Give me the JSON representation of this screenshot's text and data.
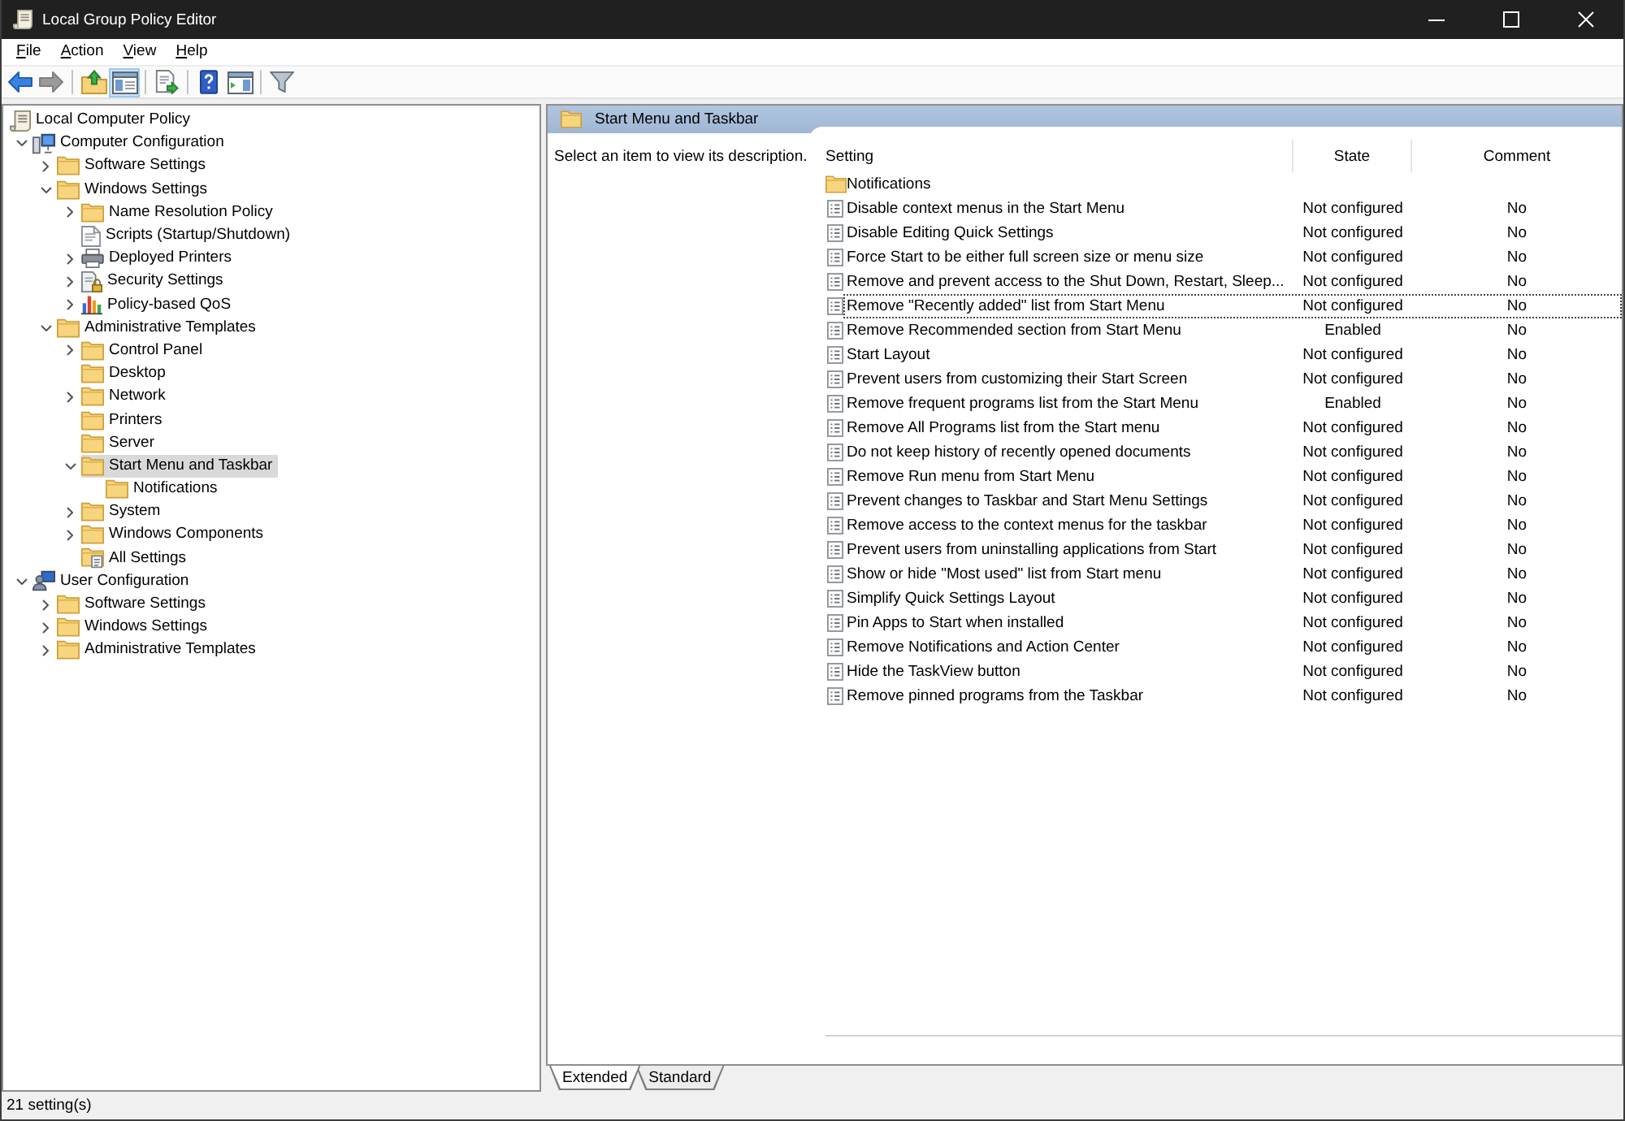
{
  "window": {
    "title": "Local Group Policy Editor"
  },
  "menu": [
    "File",
    "Action",
    "View",
    "Help"
  ],
  "toolbar": {
    "groups": [
      {
        "buttons": [
          {
            "kind": "back",
            "pressed": false,
            "disabled": false
          },
          {
            "kind": "forward",
            "pressed": false,
            "disabled": true
          }
        ]
      },
      {
        "buttons": [
          {
            "kind": "up",
            "pressed": false,
            "disabled": false
          },
          {
            "kind": "tree",
            "pressed": true,
            "disabled": false
          }
        ]
      },
      {
        "buttons": [
          {
            "kind": "export",
            "pressed": false,
            "disabled": false
          }
        ]
      },
      {
        "buttons": [
          {
            "kind": "help",
            "pressed": false,
            "disabled": false
          },
          {
            "kind": "actions",
            "pressed": false,
            "disabled": false
          }
        ]
      },
      {
        "buttons": [
          {
            "kind": "filter",
            "pressed": false,
            "disabled": false
          }
        ]
      }
    ]
  },
  "tree": [
    {
      "label": "Local Computer Policy",
      "kind": "policy",
      "selected": false,
      "children": [
        {
          "label": "Computer Configuration",
          "kind": "computer",
          "selected": false,
          "expanded": true,
          "children": [
            {
              "label": "Software Settings",
              "kind": "folder",
              "selected": false,
              "expanded": false
            },
            {
              "label": "Windows Settings",
              "kind": "folder",
              "selected": false,
              "expanded": true,
              "children": [
                {
                  "label": "Name Resolution Policy",
                  "kind": "folder",
                  "selected": false,
                  "expanded": false
                },
                {
                  "label": "Scripts (Startup/Shutdown)",
                  "kind": "script",
                  "selected": false
                },
                {
                  "label": "Deployed Printers",
                  "kind": "printer",
                  "selected": false,
                  "expanded": false
                },
                {
                  "label": "Security Settings",
                  "kind": "security",
                  "selected": false,
                  "expanded": false
                },
                {
                  "label": "Policy-based QoS",
                  "kind": "chart",
                  "selected": false,
                  "expanded": false
                }
              ]
            },
            {
              "label": "Administrative Templates",
              "kind": "folder",
              "selected": false,
              "expanded": true,
              "children": [
                {
                  "label": "Control Panel",
                  "kind": "folder",
                  "selected": false,
                  "expanded": false
                },
                {
                  "label": "Desktop",
                  "kind": "folder",
                  "selected": false
                },
                {
                  "label": "Network",
                  "kind": "folder",
                  "selected": false,
                  "expanded": false
                },
                {
                  "label": "Printers",
                  "kind": "folder",
                  "selected": false
                },
                {
                  "label": "Server",
                  "kind": "folder",
                  "selected": false
                },
                {
                  "label": "Start Menu and Taskbar",
                  "kind": "folder",
                  "selected": true,
                  "expanded": true,
                  "children": [
                    {
                      "label": "Notifications",
                      "kind": "folder",
                      "selected": false
                    }
                  ]
                },
                {
                  "label": "System",
                  "kind": "folder",
                  "selected": false,
                  "expanded": false
                },
                {
                  "label": "Windows Components",
                  "kind": "folder",
                  "selected": false,
                  "expanded": false
                },
                {
                  "label": "All Settings",
                  "kind": "settings",
                  "selected": false
                }
              ]
            }
          ]
        },
        {
          "label": "User Configuration",
          "kind": "user",
          "selected": false,
          "expanded": true,
          "children": [
            {
              "label": "Software Settings",
              "kind": "folder",
              "selected": false,
              "expanded": false
            },
            {
              "label": "Windows Settings",
              "kind": "folder",
              "selected": false,
              "expanded": false
            },
            {
              "label": "Administrative Templates",
              "kind": "folder",
              "selected": false,
              "expanded": false
            }
          ]
        }
      ]
    }
  ],
  "details": {
    "title": "Start Menu and Taskbar",
    "description": "Select an item to view its description.",
    "columns": [
      "Setting",
      "State",
      "Comment"
    ],
    "rows": [
      {
        "kind": "folder",
        "setting": "Notifications",
        "focused": false
      },
      {
        "kind": "setting",
        "setting": "Disable context menus in the Start Menu",
        "state": "Not configured",
        "comment": "No",
        "focused": false
      },
      {
        "kind": "setting",
        "setting": "Disable Editing Quick Settings",
        "state": "Not configured",
        "comment": "No",
        "focused": false
      },
      {
        "kind": "setting",
        "setting": "Force Start to be either full screen size or menu size",
        "state": "Not configured",
        "comment": "No",
        "focused": false
      },
      {
        "kind": "setting",
        "setting": "Remove and prevent access to the Shut Down, Restart, Sleep...",
        "state": "Not configured",
        "comment": "No",
        "focused": false
      },
      {
        "kind": "setting",
        "setting": "Remove \"Recently added\" list from Start Menu",
        "state": "Not configured",
        "comment": "No",
        "focused": true
      },
      {
        "kind": "setting",
        "setting": "Remove Recommended section from Start Menu",
        "state": "Enabled",
        "comment": "No",
        "focused": false
      },
      {
        "kind": "setting",
        "setting": "Start Layout",
        "state": "Not configured",
        "comment": "No",
        "focused": false
      },
      {
        "kind": "setting",
        "setting": "Prevent users from customizing their Start Screen",
        "state": "Not configured",
        "comment": "No",
        "focused": false
      },
      {
        "kind": "setting",
        "setting": "Remove frequent programs list from the Start Menu",
        "state": "Enabled",
        "comment": "No",
        "focused": false
      },
      {
        "kind": "setting",
        "setting": "Remove All Programs list from the Start menu",
        "state": "Not configured",
        "comment": "No",
        "focused": false
      },
      {
        "kind": "setting",
        "setting": "Do not keep history of recently opened documents",
        "state": "Not configured",
        "comment": "No",
        "focused": false
      },
      {
        "kind": "setting",
        "setting": "Remove Run menu from Start Menu",
        "state": "Not configured",
        "comment": "No",
        "focused": false
      },
      {
        "kind": "setting",
        "setting": "Prevent changes to Taskbar and Start Menu Settings",
        "state": "Not configured",
        "comment": "No",
        "focused": false
      },
      {
        "kind": "setting",
        "setting": "Remove access to the context menus for the taskbar",
        "state": "Not configured",
        "comment": "No",
        "focused": false
      },
      {
        "kind": "setting",
        "setting": "Prevent users from uninstalling applications from Start",
        "state": "Not configured",
        "comment": "No",
        "focused": false
      },
      {
        "kind": "setting",
        "setting": "Show or hide \"Most used\" list from Start menu",
        "state": "Not configured",
        "comment": "No",
        "focused": false
      },
      {
        "kind": "setting",
        "setting": "Simplify Quick Settings Layout",
        "state": "Not configured",
        "comment": "No",
        "focused": false
      },
      {
        "kind": "setting",
        "setting": "Pin Apps to Start when installed",
        "state": "Not configured",
        "comment": "No",
        "focused": false
      },
      {
        "kind": "setting",
        "setting": "Remove Notifications and Action Center",
        "state": "Not configured",
        "comment": "No",
        "focused": false
      },
      {
        "kind": "setting",
        "setting": "Hide the TaskView button",
        "state": "Not configured",
        "comment": "No",
        "focused": false
      },
      {
        "kind": "setting",
        "setting": "Remove pinned programs from the Taskbar",
        "state": "Not configured",
        "comment": "No",
        "focused": false
      }
    ]
  },
  "view_tabs": [
    {
      "label": "Extended",
      "selected": true
    },
    {
      "label": "Standard",
      "selected": false
    }
  ],
  "status_bar": "21 setting(s)"
}
